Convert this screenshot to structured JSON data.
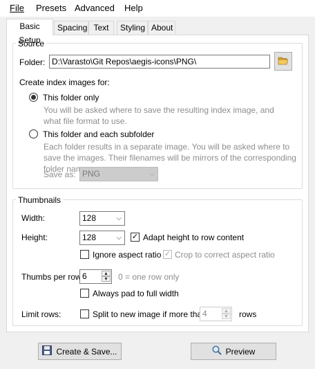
{
  "menu": {
    "file": "File",
    "presets": "Presets",
    "advanced": "Advanced",
    "help": "Help"
  },
  "tabs": [
    {
      "label": "Basic Setup",
      "active": true
    },
    {
      "label": "Spacing",
      "active": false
    },
    {
      "label": "Text",
      "active": false
    },
    {
      "label": "Styling",
      "active": false
    },
    {
      "label": "About",
      "active": false
    }
  ],
  "source": {
    "title": "Source",
    "folder_label": "Folder:",
    "folder_value": "D:\\Varasto\\Git Repos\\aegis-icons\\PNG\\",
    "browse_icon": "folder-open-icon",
    "create_index_label": "Create index images for:",
    "option1_label": "This folder only",
    "option1_selected": true,
    "option1_hint": "You will be asked where to save the resulting index image, and what file format to use.",
    "option2_label": "This folder and each subfolder",
    "option2_selected": false,
    "option2_hint": "Each folder results in a separate image. You will be asked where to save the images. Their filenames will be mirrors of the corresponding folder name.",
    "save_as_label": "Save as:",
    "save_as_value": "PNG"
  },
  "thumbnails": {
    "title": "Thumbnails",
    "width_label": "Width:",
    "width_value": "128",
    "height_label": "Height:",
    "height_value": "128",
    "adapt_height_label": "Adapt height to row content",
    "adapt_height_checked": true,
    "ignore_aspect_label": "Ignore aspect ratio",
    "ignore_aspect_checked": false,
    "crop_label": "Crop to correct aspect ratio",
    "crop_checked": true,
    "thumbs_per_row_label": "Thumbs per row:",
    "thumbs_per_row_value": "6",
    "thumbs_per_row_hint": "0 = one row only",
    "always_pad_label": "Always pad to full width",
    "always_pad_checked": false,
    "limit_rows_label": "Limit rows:",
    "split_label": "Split to new image if more than",
    "split_checked": false,
    "split_value": "4",
    "rows_label": "rows"
  },
  "footer": {
    "create_save_label": "Create & Save...",
    "create_save_icon": "save-disk-icon",
    "preview_label": "Preview",
    "preview_icon": "magnifier-icon"
  },
  "colors": {
    "window_bg": "#f0f0f0",
    "panel_bg": "#ffffff",
    "disabled_text": "#8d8d8d",
    "folder_icon": "#e8b33e"
  }
}
